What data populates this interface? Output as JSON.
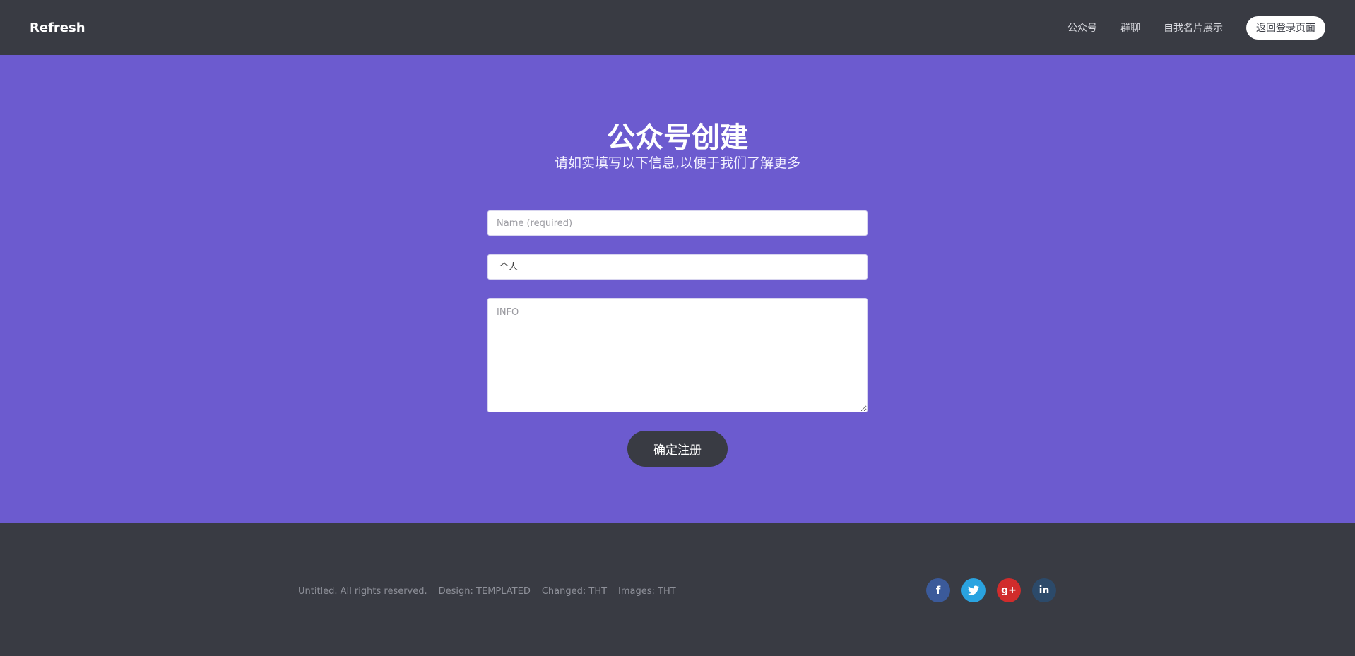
{
  "nav": {
    "brand": "Refresh",
    "links": [
      "公众号",
      "群聊",
      "自我名片展示"
    ],
    "login_button": "返回登录页面"
  },
  "hero": {
    "title": "公众号创建",
    "subtitle": "请如实填写以下信息,以便于我们了解更多"
  },
  "form": {
    "name_placeholder": "Name (required)",
    "type_selected": "个人",
    "info_placeholder": "INFO",
    "submit_label": "确定注册"
  },
  "footer": {
    "copyright": "Untitled. All rights reserved.",
    "design": "Design: TEMPLATED",
    "changed": "Changed: THT",
    "images": "Images: THT"
  },
  "social": {
    "facebook": "f",
    "twitter": "t",
    "googleplus": "g+",
    "linkedin": "in"
  },
  "colors": {
    "nav_bg": "#393b43",
    "hero_bg": "#6c5bcf",
    "button_bg": "#393b43",
    "facebook": "#3b5a9a",
    "twitter": "#2aa3e0",
    "googleplus": "#d12c2c",
    "linkedin": "#2c4a6a"
  }
}
